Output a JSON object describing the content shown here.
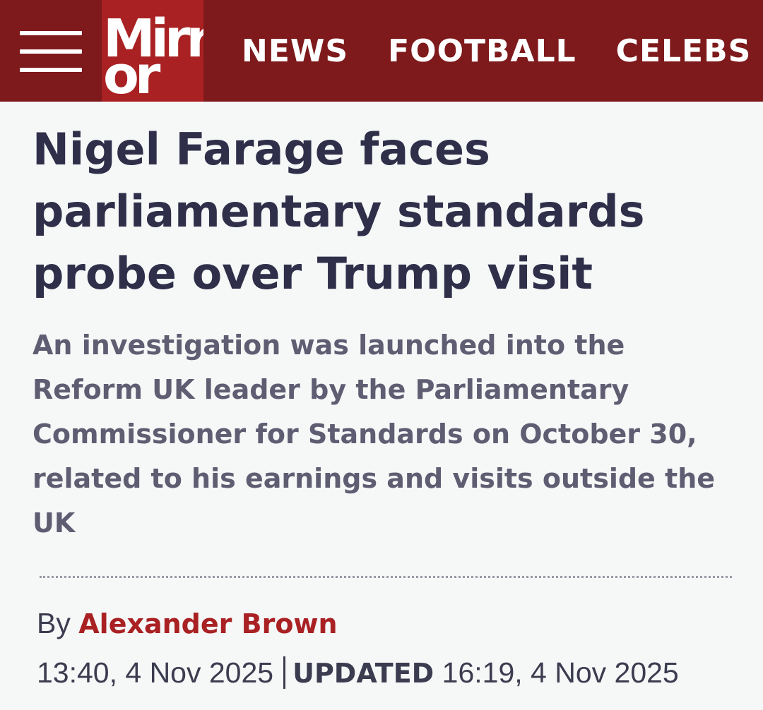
{
  "header": {
    "logo_line1": "Mirr",
    "logo_line2": "or",
    "nav": [
      "NEWS",
      "FOOTBALL",
      "CELEBS"
    ],
    "colors": {
      "bar": "#7e1a1c",
      "logo_bg": "#a92123"
    },
    "menu_icon": "hamburger-menu-icon"
  },
  "article": {
    "headline": "Nigel Farage faces parliamentary standards probe over Trump visit",
    "standfirst": "An investigation was launched into the Reform UK leader by the Parliamentary Commissioner for Standards on October 30, related to his earnings and visits outside the UK",
    "byline_prefix": "By",
    "author": "Alexander Brown",
    "published": "13:40, 4 Nov 2025",
    "updated_label": "UPDATED",
    "updated": "16:19, 4 Nov 2025"
  }
}
